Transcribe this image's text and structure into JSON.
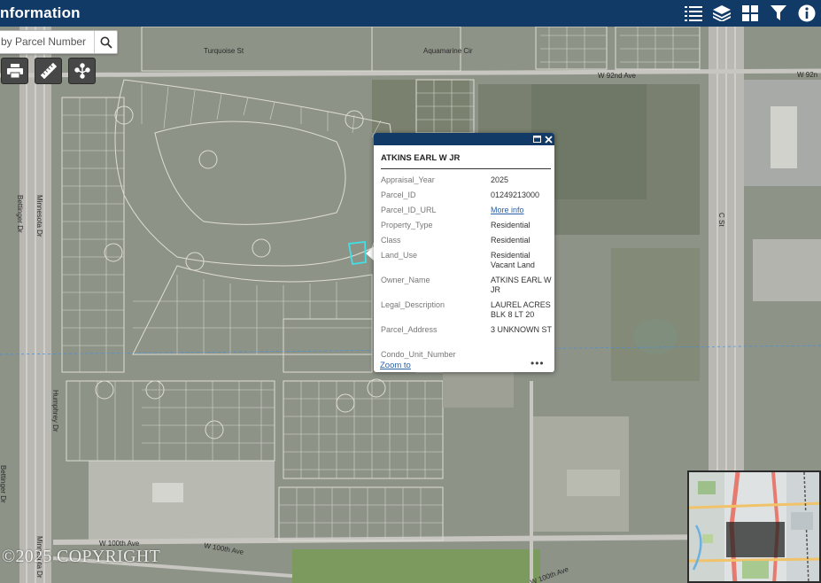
{
  "header": {
    "title": "nformation"
  },
  "search": {
    "placeholder": "by Parcel Number"
  },
  "map_labels": {
    "turquoise": "Turquoise St",
    "aquamarine": "Aquamarine Cir",
    "w92": "W 92nd Ave",
    "w92b": "W 92n",
    "minnesota1": "Minnesota Dr",
    "minnesota2": "Minnesota Dr",
    "bettinger1": "Bettinger Dr",
    "bettinger2": "Bettinger Dr",
    "humphrey": "Humphrey Dr",
    "cst": "C St",
    "w100a": "W 100th Ave",
    "w100b": "W 100th Ave",
    "w100c": "W 100th Ave"
  },
  "popup": {
    "title": "ATKINS EARL W JR",
    "fields": [
      {
        "key": "Appraisal_Year",
        "value": "2025"
      },
      {
        "key": "Parcel_ID",
        "value": "01249213000"
      },
      {
        "key": "Parcel_ID_URL",
        "value": "More info"
      },
      {
        "key": "Property_Type",
        "value": "Residential"
      },
      {
        "key": "Class",
        "value": "Residential"
      },
      {
        "key": "Land_Use",
        "value": "Residential Vacant Land"
      },
      {
        "key": "Owner_Name",
        "value": "ATKINS EARL W JR"
      },
      {
        "key": "Legal_Description",
        "value": "LAUREL ACRES BLK 8 LT 20"
      },
      {
        "key": "Parcel_Address",
        "value": "3 UNKNOWN ST"
      },
      {
        "key": "Condo_Unit_Number",
        "value": ""
      }
    ],
    "zoom_label": "Zoom to",
    "more_label": "•••"
  },
  "watermark": "©2025 COPYRIGHT",
  "colors": {
    "header": "#123a66",
    "link": "#2860a8",
    "selected_parcel": "#3fe0e6"
  }
}
